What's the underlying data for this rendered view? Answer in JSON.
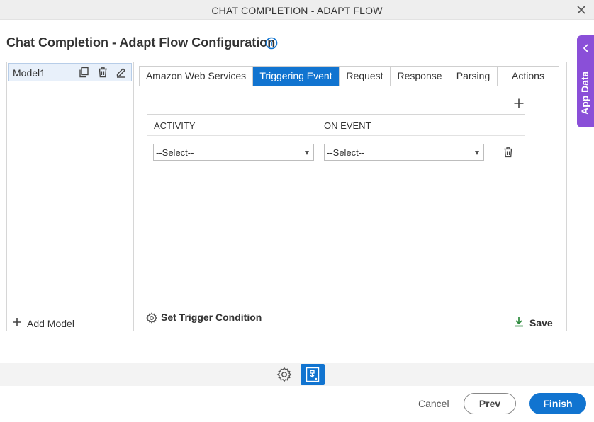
{
  "window": {
    "title": "CHAT COMPLETION - ADAPT FLOW",
    "close_icon": "close-icon"
  },
  "page": {
    "title": "Chat Completion - Adapt Flow Configuration",
    "info_icon": "info-icon"
  },
  "app_data": {
    "label": "App Data",
    "icon": "chevron-left-icon"
  },
  "models": {
    "items": [
      {
        "name": "Model1",
        "icons": [
          "copy-icon",
          "trash-icon",
          "edit-icon"
        ]
      }
    ],
    "add_label": "Add Model"
  },
  "tabs": [
    {
      "label": "Amazon Web Services",
      "active": false
    },
    {
      "label": "Triggering Event",
      "active": true
    },
    {
      "label": "Request",
      "active": false
    },
    {
      "label": "Response",
      "active": false
    },
    {
      "label": "Parsing",
      "active": false
    },
    {
      "label": "Actions",
      "active": false
    }
  ],
  "grid": {
    "columns": [
      "ACTIVITY",
      "ON EVENT"
    ],
    "rows": [
      {
        "activity": "--Select--",
        "on_event": "--Select--"
      }
    ]
  },
  "actions": {
    "trigger_condition": "Set Trigger Condition",
    "save": "Save"
  },
  "footer": {
    "cancel": "Cancel",
    "prev": "Prev",
    "finish": "Finish"
  },
  "colors": {
    "primary": "#1174d0",
    "app_data": "#8a4fd8",
    "save_icon": "#2e8b3e"
  }
}
